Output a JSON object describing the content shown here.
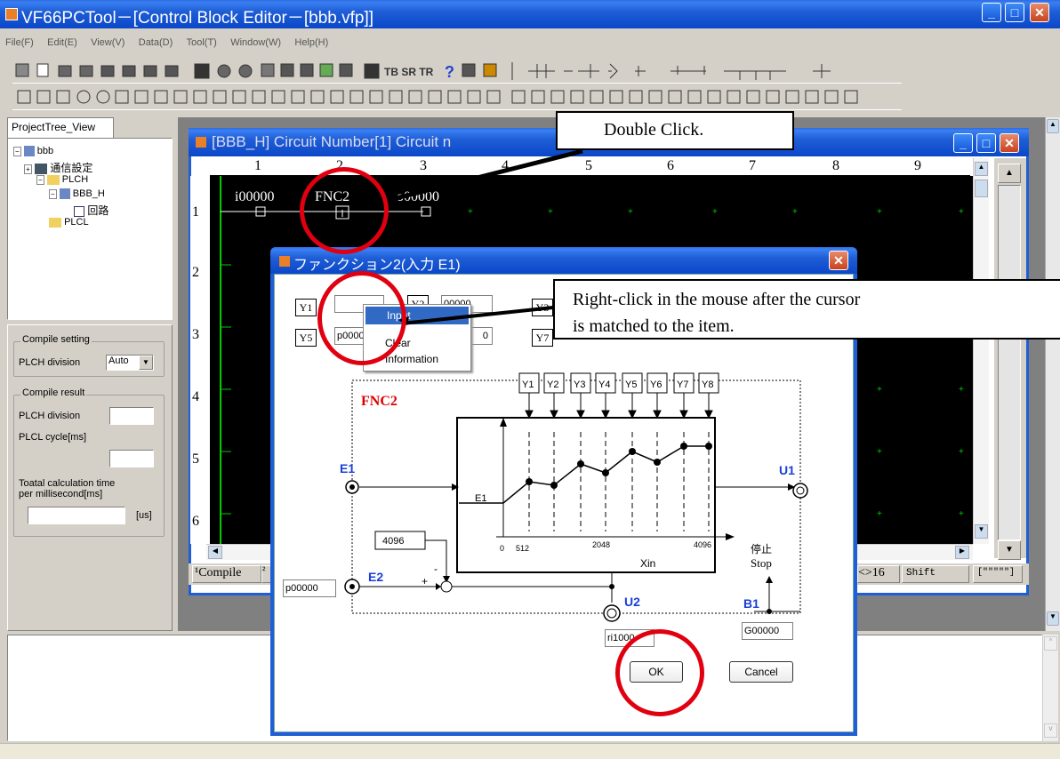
{
  "app": {
    "title": "VF66PCTool－[Control Block Editor－[bbb.vfp]]",
    "menu": [
      "File(F)",
      "Edit(E)",
      "View(V)",
      "Data(D)",
      "Tool(T)",
      "Window(W)",
      "Help(H)"
    ]
  },
  "tree": {
    "tab": "ProjectTree_View",
    "items": [
      "bbb",
      "通信設定",
      "PLCH",
      "BBB_H",
      "回路",
      "PLCL"
    ]
  },
  "compile_setting": {
    "group": "Compile setting",
    "plch_label": "PLCH division",
    "plch_value": "Auto"
  },
  "compile_result": {
    "group": "Compile result",
    "plch_label": "PLCH division",
    "plcl_label": "PLCL cycle[ms]",
    "total_label_1": "Toatal calculation time",
    "total_label_2": "per millisecond[ms]",
    "unit": "[us]"
  },
  "circuit_window": {
    "title": "[BBB_H] Circuit Number[1] Circuit n",
    "columns": [
      "1",
      "2",
      "3",
      "4",
      "5",
      "6",
      "7",
      "8",
      "9"
    ],
    "rows": [
      "1",
      "2",
      "3",
      "4",
      "5",
      "6"
    ],
    "element1": "i00000",
    "element2": "FNC2",
    "element3": "o00000",
    "bottom_tab1": "¹Compile",
    "bottom_tab2": "²",
    "bottom_right1": "<>16",
    "bottom_right2": "Shift",
    "bottom_right3": "[\"\"\"\"\"]"
  },
  "dialog": {
    "title": "ファンクション2(入力 E1)",
    "y_labels": [
      "Y1",
      "Y2",
      "Y3",
      "Y5",
      "Y7"
    ],
    "y2_value": "00000",
    "y5_value": "p0000",
    "y6_value": "0",
    "context_menu": [
      "Input",
      "Clear",
      "Information"
    ],
    "diagram": {
      "block": "FNC2",
      "y_boxes": [
        "Y1",
        "Y2",
        "Y3",
        "Y4",
        "Y5",
        "Y6",
        "Y7",
        "Y8"
      ],
      "e1": "E1",
      "e2": "E2",
      "u1": "U1",
      "u2": "U2",
      "b1": "B1",
      "graph_e1": "E1",
      "x_ticks": [
        "0",
        "512",
        "2048",
        "4096"
      ],
      "x_axis": "Xin",
      "const": "4096",
      "plus": "+",
      "minus": "-",
      "stop_jp": "停止",
      "stop_en": "Stop",
      "e2_value": "p00000",
      "u2_value": "ri1000",
      "b1_value": "G00000"
    },
    "ok": "OK",
    "cancel": "Cancel"
  },
  "callouts": {
    "double_click": "Double Click.",
    "right_click_1": "Right-click in the mouse after the cursor",
    "right_click_2": "is matched to the item."
  }
}
